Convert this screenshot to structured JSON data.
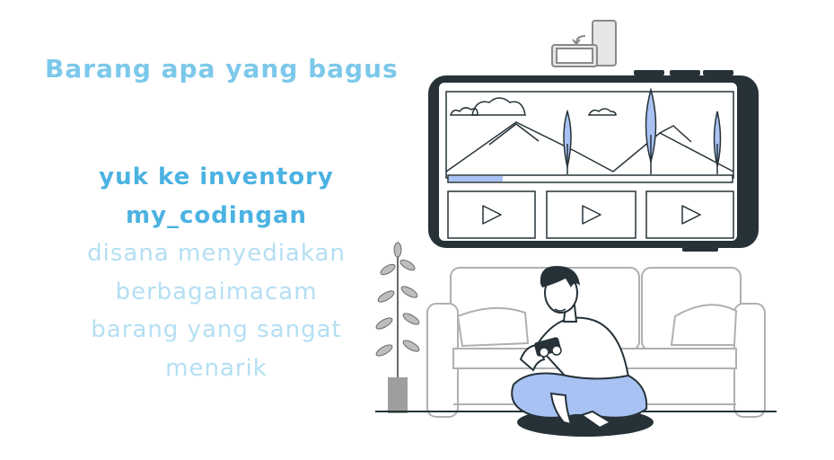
{
  "heading": "Barang apa yang bagus",
  "body": {
    "line1": "yuk ke inventory",
    "line2": "my_codingan",
    "line3": "disana menyediakan",
    "line4": "berbagaimacam",
    "line5": "barang yang sangat",
    "line6": "menarik"
  },
  "colors": {
    "heading": "#7cc8ea",
    "emphasis": "#4bb2e2",
    "body": "#b4dff3",
    "illustration_accent": "#a9c2f4",
    "illustration_outline": "#263238"
  },
  "illustration": {
    "icons": [
      "rotate-device-icon",
      "play-icon",
      "play-icon",
      "play-icon"
    ]
  }
}
